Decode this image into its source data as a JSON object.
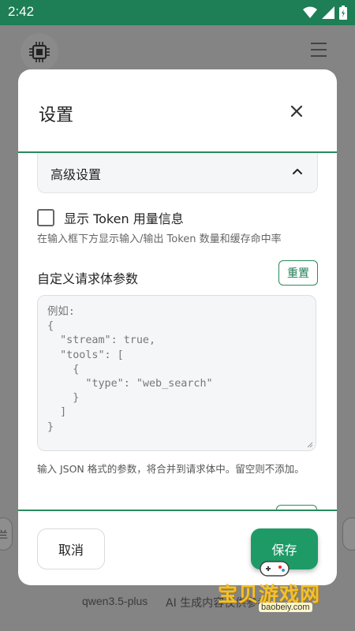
{
  "status_bar": {
    "time": "2:42"
  },
  "background": {
    "model_name": "qwen3.5-plus",
    "disclaimer": "AI 生成内容仅供参考",
    "partial_left": "兰"
  },
  "modal": {
    "title": "设置",
    "advanced_section_title": "高级设置",
    "token_checkbox_label": "显示 Token 用量信息",
    "token_checkbox_checked": false,
    "token_checkbox_desc": "在输入框下方显示输入/输出 Token 数量和缓存命中率",
    "custom_params_label": "自定义请求体参数",
    "reset_label": "重置",
    "params_placeholder": "例如:\n{\n  \"stream\": true,\n  \"tools\": [\n    {\n      \"type\": \"web_search\"\n    }\n  ]\n}",
    "params_desc": "输入 JSON 格式的参数，将合并到请求体中。留空则不添加。",
    "cancel_label": "取消",
    "save_label": "保存"
  },
  "watermark": {
    "text": "宝贝游戏网",
    "url": "baobeiy.com"
  },
  "colors": {
    "accent": "#1e9a66",
    "status_bar": "#1e7e55"
  }
}
